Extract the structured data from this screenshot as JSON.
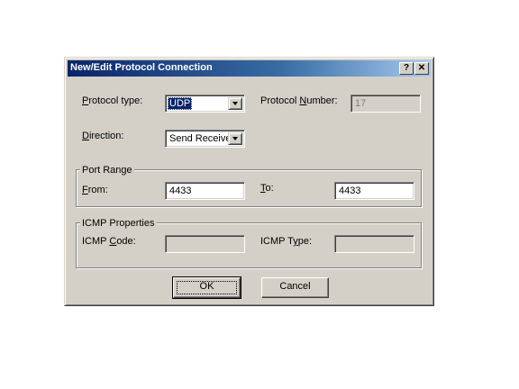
{
  "dialog": {
    "title": "New/Edit Protocol Connection",
    "help_button": "?",
    "close_button": "✕"
  },
  "protocol": {
    "type_label_accel": "P",
    "type_label_rest": "rotocol type:",
    "type_value": "UDP",
    "number_label_pre": "Protocol ",
    "number_label_accel": "N",
    "number_label_post": "umber:",
    "number_value": "17"
  },
  "direction": {
    "label_accel": "D",
    "label_rest": "irection:",
    "value": "Send Receive"
  },
  "port_range": {
    "group_title": "Port Range",
    "from_label_accel": "F",
    "from_label_rest": "rom:",
    "from_value": "4433",
    "to_label_accel": "T",
    "to_label_rest": "o:",
    "to_value": "4433"
  },
  "icmp": {
    "group_title": "ICMP Properties",
    "code_label_pre": "ICMP ",
    "code_label_accel": "C",
    "code_label_post": "ode:",
    "code_value": "",
    "type_label_pre": "ICMP T",
    "type_label_accel": "y",
    "type_label_post": "pe:",
    "type_value": ""
  },
  "buttons": {
    "ok": "OK",
    "cancel": "Cancel"
  }
}
